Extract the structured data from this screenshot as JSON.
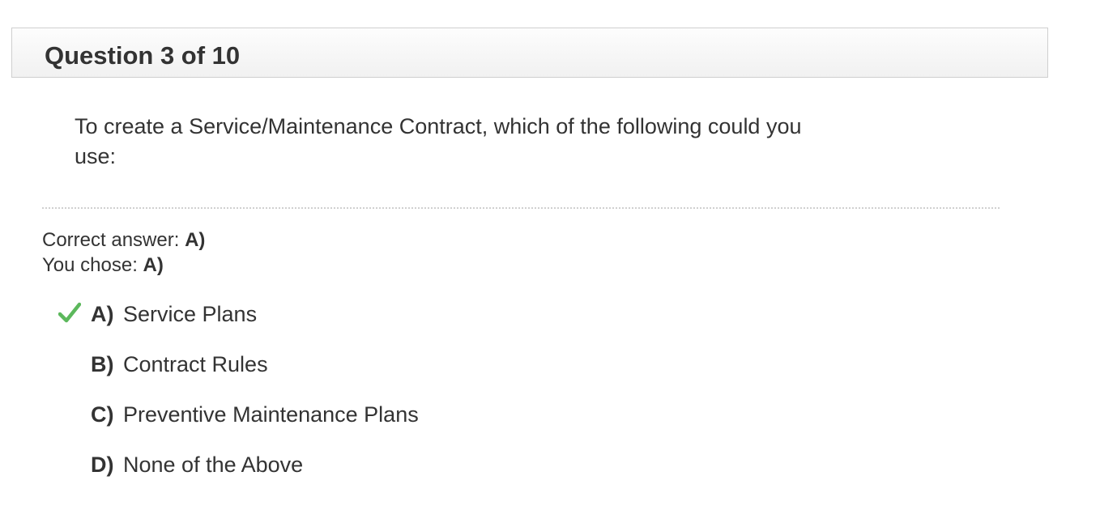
{
  "header": {
    "title": "Question 3 of 10"
  },
  "question": {
    "text": "To create a Service/Maintenance Contract, which of the following could you use:"
  },
  "result": {
    "correct_label": "Correct answer: ",
    "correct_value": "A)",
    "chosen_label": "You chose: ",
    "chosen_value": "A)"
  },
  "options": [
    {
      "letter": "A)",
      "text": "Service Plans",
      "icon": "check-icon",
      "selected_correct": true
    },
    {
      "letter": "B)",
      "text": "Contract Rules"
    },
    {
      "letter": "C)",
      "text": "Preventive Maintenance Plans"
    },
    {
      "letter": "D)",
      "text": "None of the Above"
    }
  ],
  "colors": {
    "check": "#5cb85c",
    "text": "#333333",
    "header_border": "#cfcfcf"
  }
}
